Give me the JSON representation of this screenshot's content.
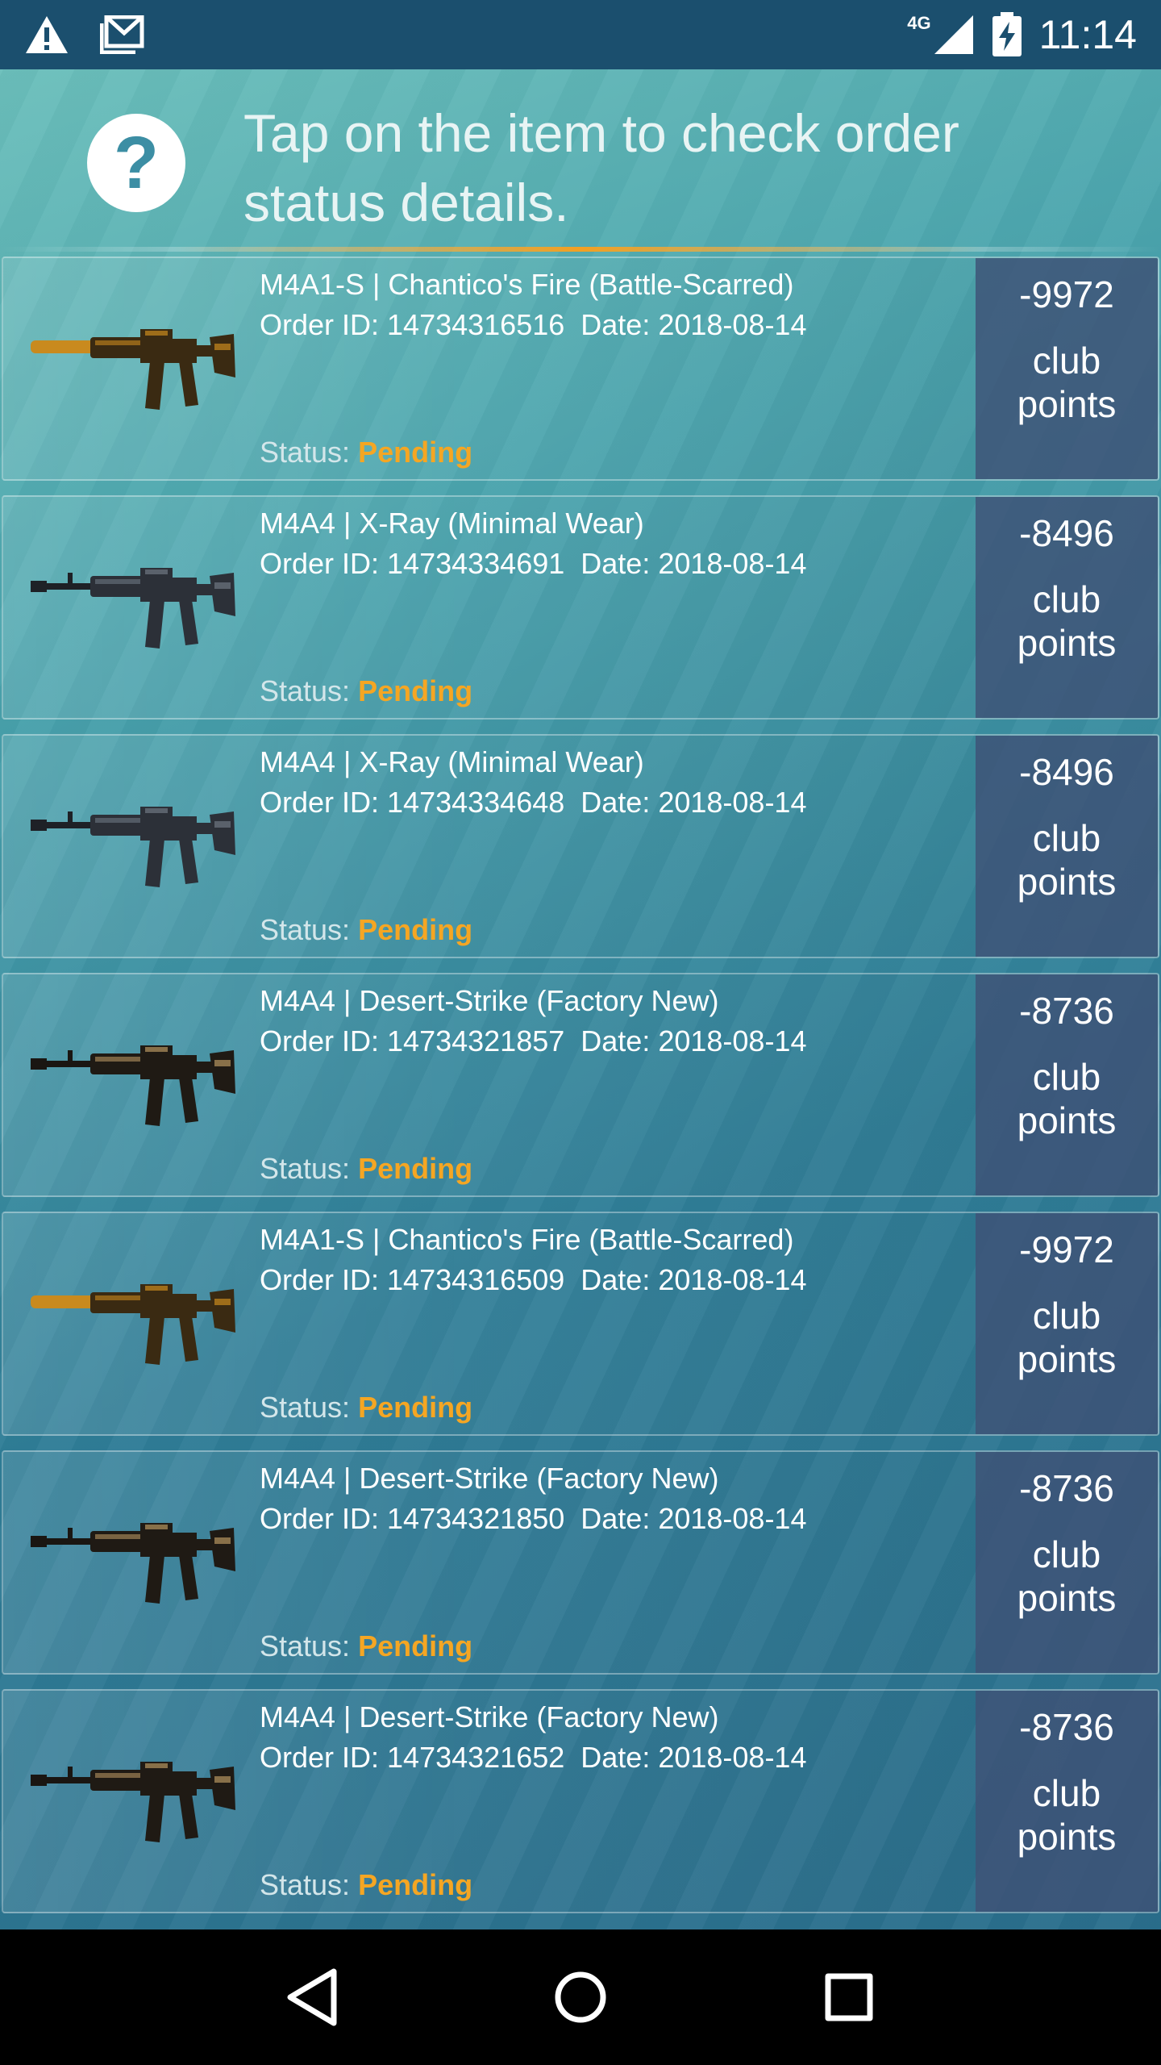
{
  "status_bar": {
    "time": "11:14",
    "network": "4G",
    "icons": [
      "warning-icon",
      "mail-icon",
      "signal-icon",
      "battery-charging-icon"
    ]
  },
  "header": {
    "help_icon": "?",
    "text": "Tap on the item to check order status details."
  },
  "orders": [
    {
      "name": "M4A1-S | Chantico's Fire (Battle-Scarred)",
      "order_id": "Order ID: 14734316516",
      "date": "Date: 2018-08-14",
      "status_label": "Status:",
      "status": "Pending",
      "points": "-9972",
      "points_label": "club points",
      "weapon": "m4a1s-chantico"
    },
    {
      "name": "M4A4 | X-Ray (Minimal Wear)",
      "order_id": "Order ID: 14734334691",
      "date": "Date: 2018-08-14",
      "status_label": "Status:",
      "status": "Pending",
      "points": "-8496",
      "points_label": "club points",
      "weapon": "m4a4-xray"
    },
    {
      "name": "M4A4 | X-Ray (Minimal Wear)",
      "order_id": "Order ID: 14734334648",
      "date": "Date: 2018-08-14",
      "status_label": "Status:",
      "status": "Pending",
      "points": "-8496",
      "points_label": "club points",
      "weapon": "m4a4-xray"
    },
    {
      "name": "M4A4 | Desert-Strike (Factory New)",
      "order_id": "Order ID: 14734321857",
      "date": "Date: 2018-08-14",
      "status_label": "Status:",
      "status": "Pending",
      "points": "-8736",
      "points_label": "club points",
      "weapon": "m4a4-desert"
    },
    {
      "name": "M4A1-S | Chantico's Fire (Battle-Scarred)",
      "order_id": "Order ID: 14734316509",
      "date": "Date: 2018-08-14",
      "status_label": "Status:",
      "status": "Pending",
      "points": "-9972",
      "points_label": "club points",
      "weapon": "m4a1s-chantico"
    },
    {
      "name": "M4A4 | Desert-Strike (Factory New)",
      "order_id": "Order ID: 14734321850",
      "date": "Date: 2018-08-14",
      "status_label": "Status:",
      "status": "Pending",
      "points": "-8736",
      "points_label": "club points",
      "weapon": "m4a4-desert"
    },
    {
      "name": "M4A4 | Desert-Strike (Factory New)",
      "order_id": "Order ID: 14734321652",
      "date": "Date: 2018-08-14",
      "status_label": "Status:",
      "status": "Pending",
      "points": "-8736",
      "points_label": "club points",
      "weapon": "m4a4-desert"
    }
  ],
  "colors": {
    "accent": "#f5a623",
    "status_bar": "#1b4f6e",
    "points_box": "#3e5276"
  },
  "nav": {
    "icons": [
      "back-icon",
      "home-icon",
      "recents-icon"
    ]
  }
}
